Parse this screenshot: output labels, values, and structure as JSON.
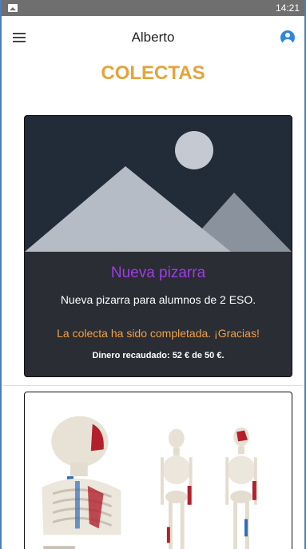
{
  "statusbar": {
    "time": "14:21"
  },
  "toolbar": {
    "title": "Alberto"
  },
  "page": {
    "title": "COLECTAS"
  },
  "collections": [
    {
      "title": "Nueva pizarra",
      "description": "Nueva pizarra para alumnos de 2 ESO.",
      "status": "La colecta ha sido completada. ¡Gracias!",
      "money": "Dinero recaudado: 52 € de 50 €."
    }
  ],
  "colors": {
    "accent": "#e5a33b",
    "card_title": "#a03ce8",
    "status": "#f0a04a",
    "avatar": "#2e86de"
  }
}
